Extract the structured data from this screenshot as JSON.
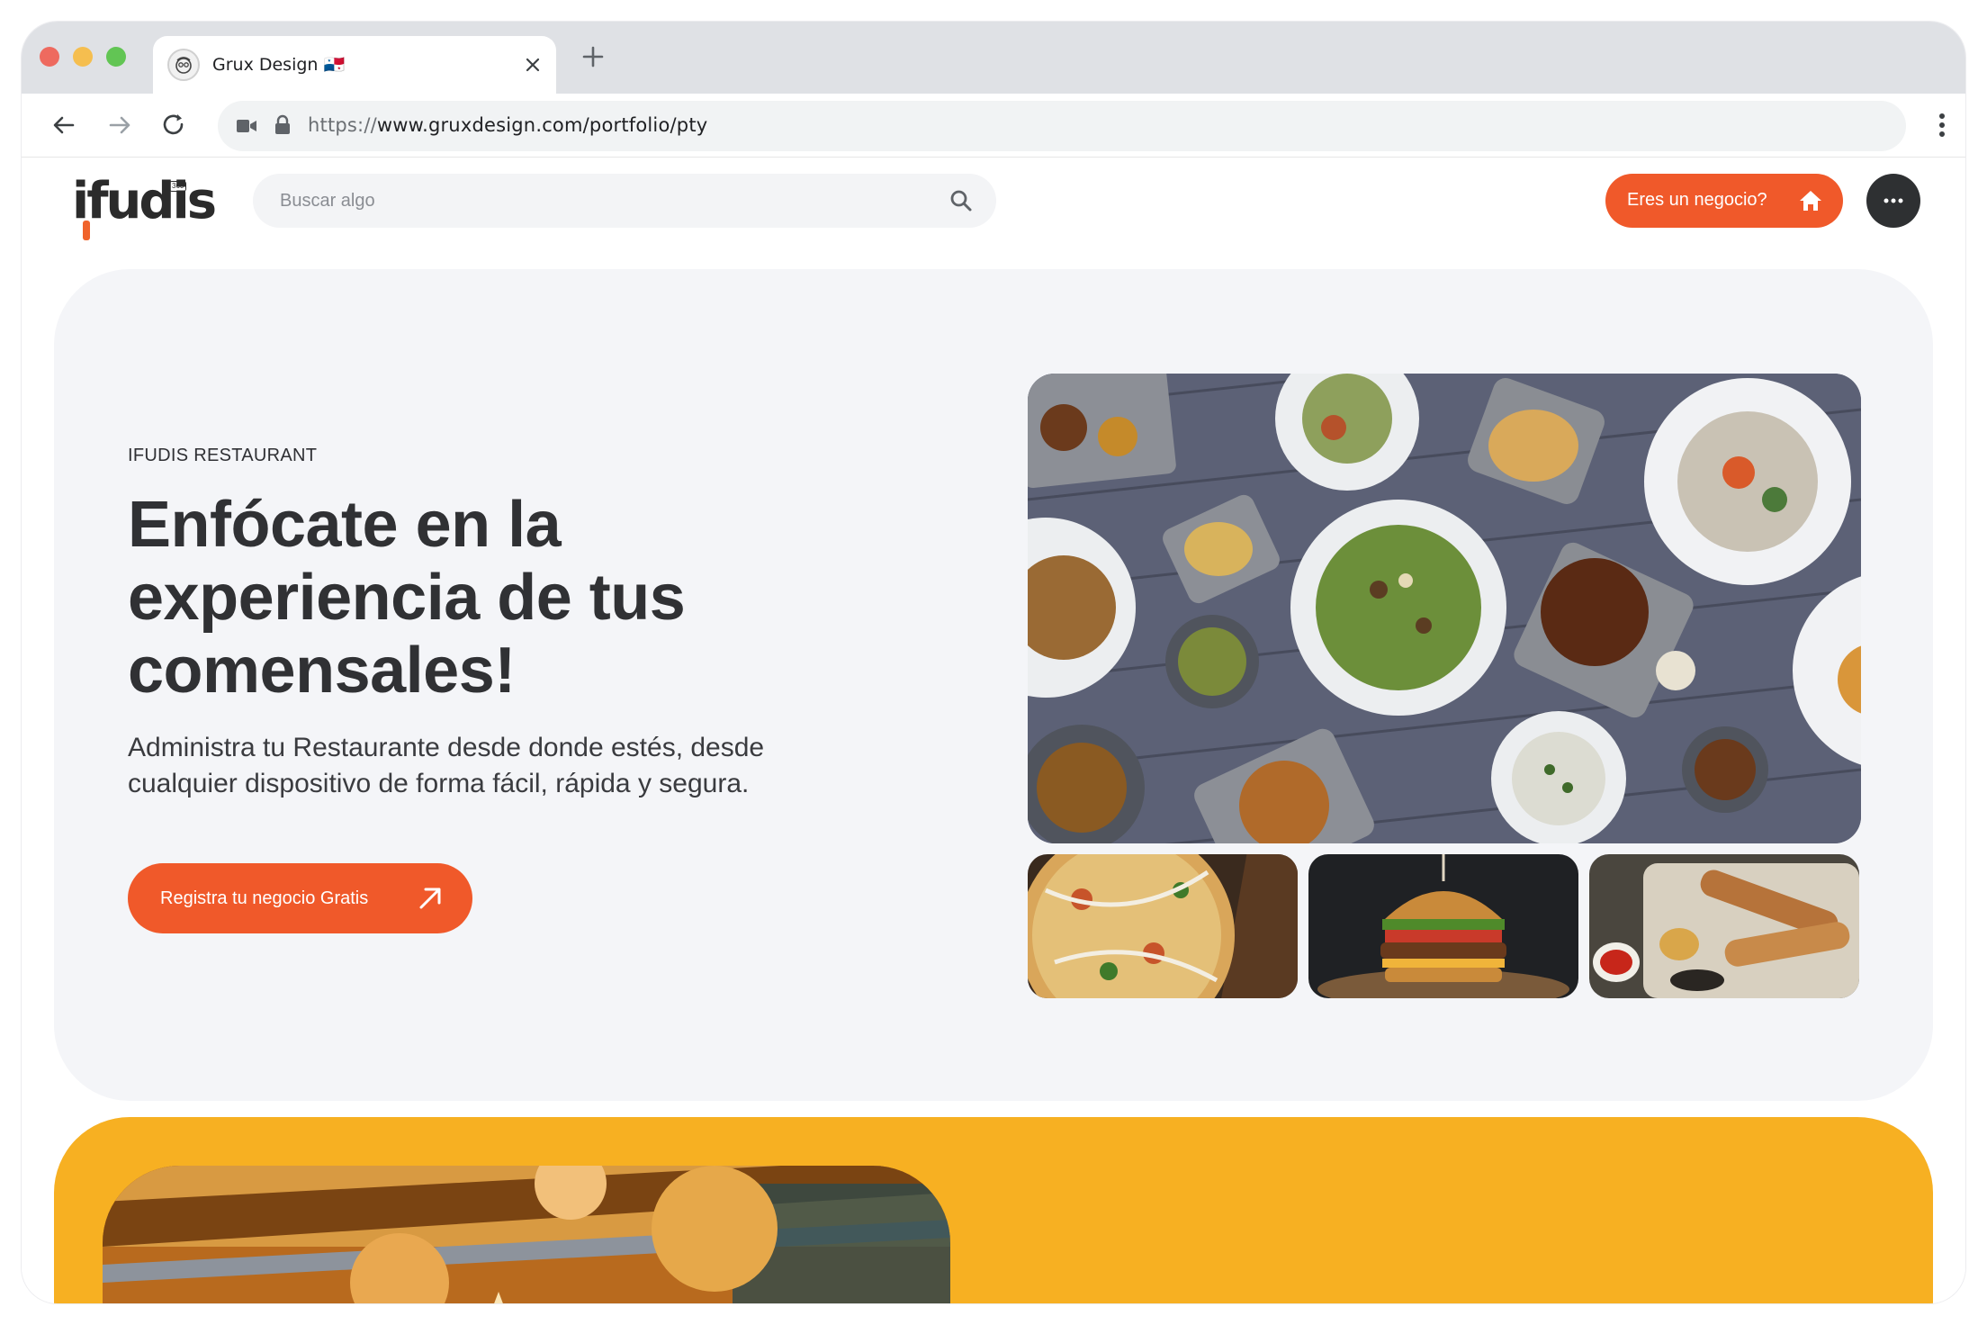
{
  "browser": {
    "tab_title": "Grux Design 🇵🇦",
    "new_tab_icon": "plus-icon",
    "url_scheme": "https://",
    "url_rest": "www.gruxdesign.com/portfolio/pty"
  },
  "header": {
    "logo_text": "ifudis",
    "logo_badge": "360",
    "search_placeholder": "Buscar algo",
    "business_button": "Eres un negocio?",
    "accent_color": "#f0592a"
  },
  "hero": {
    "eyebrow": "IFUDIS RESTAURANT",
    "headline": "Enfócate en la experiencia de tus comensales!",
    "subline": "Administra tu Restaurante desde donde estés, desde cualquier dispositivo de forma fácil, rápida y segura.",
    "cta_label": "Registra tu negocio Gratis"
  },
  "colors": {
    "hero_bg": "#f4f5f8",
    "promo_bg": "#f7b022",
    "text_dark": "#303134"
  }
}
